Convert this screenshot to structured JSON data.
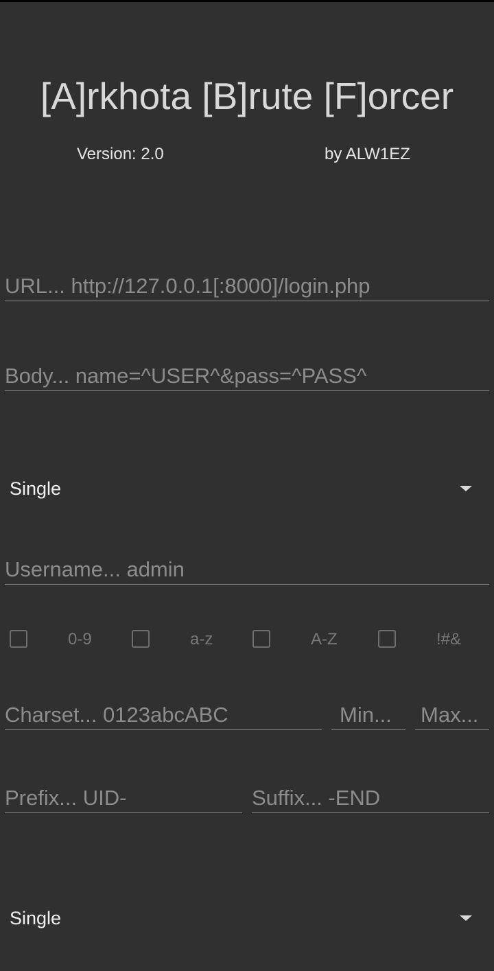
{
  "header": {
    "title": "[A]rkhota [B]rute [F]orcer",
    "version": "Version: 2.0",
    "author": "by ALW1EZ"
  },
  "form": {
    "url_placeholder": "URL... http://127.0.0.1[:8000]/login.php",
    "body_placeholder": "Body... name=^USER^&pass=^PASS^",
    "username_mode": "Single",
    "username_placeholder": "Username... admin",
    "charset_options": [
      {
        "label": "0-9",
        "checked": false
      },
      {
        "label": "a-z",
        "checked": false
      },
      {
        "label": "A-Z",
        "checked": false
      },
      {
        "label": "!#&",
        "checked": false
      }
    ],
    "charset_placeholder": "Charset... 0123abcABC",
    "min_placeholder": "Min...",
    "max_placeholder": "Max...",
    "prefix_placeholder": "Prefix... UID-",
    "suffix_placeholder": "Suffix... -END",
    "password_mode": "Single"
  }
}
